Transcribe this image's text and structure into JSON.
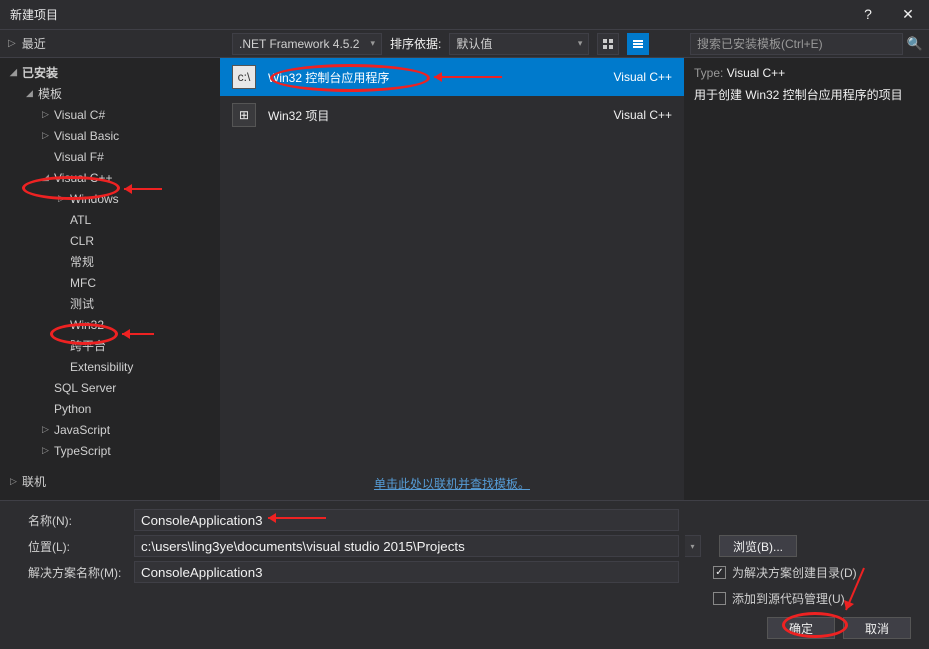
{
  "titlebar": {
    "title": "新建项目"
  },
  "topbar": {
    "recent": "最近",
    "framework": ".NET Framework 4.5.2",
    "sort_label": "排序依据:",
    "sort_value": "默认值",
    "search_placeholder": "搜索已安装模板(Ctrl+E)"
  },
  "sidebar": {
    "installed": "已安装",
    "templates": "模板",
    "csharp": "Visual C#",
    "vb": "Visual Basic",
    "fsharp": "Visual F#",
    "vcpp": "Visual C++",
    "windows": "Windows",
    "atl": "ATL",
    "clr": "CLR",
    "general": "常规",
    "mfc": "MFC",
    "test": "测试",
    "win32": "Win32",
    "crossplat": "跨平台",
    "ext": "Extensibility",
    "sql": "SQL Server",
    "python": "Python",
    "js": "JavaScript",
    "ts": "TypeScript",
    "online": "联机"
  },
  "templates": [
    {
      "name": "Win32 控制台应用程序",
      "lang": "Visual C++",
      "icon": "c:\\"
    },
    {
      "name": "Win32 项目",
      "lang": "Visual C++",
      "icon": "⊞"
    }
  ],
  "findlink": "单击此处以联机并查找模板。",
  "details": {
    "type_label": "Type:",
    "type_value": "Visual C++",
    "desc": "用于创建 Win32 控制台应用程序的项目"
  },
  "bottom": {
    "name_label": "名称(N):",
    "name_value": "ConsoleApplication3",
    "location_label": "位置(L):",
    "location_value": "c:\\users\\ling3ye\\documents\\visual studio 2015\\Projects",
    "browse": "浏览(B)...",
    "solution_label": "解决方案名称(M):",
    "solution_value": "ConsoleApplication3",
    "chk_createdir": "为解决方案创建目录(D)",
    "chk_addsource": "添加到源代码管理(U)",
    "ok": "确定",
    "cancel": "取消"
  }
}
